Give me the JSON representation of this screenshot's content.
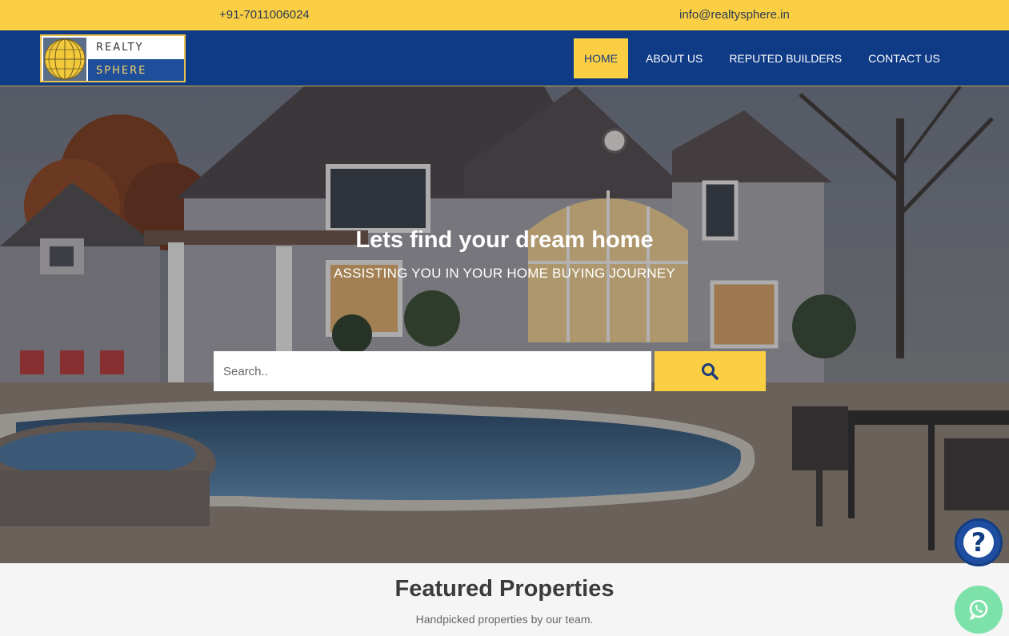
{
  "topbar": {
    "phone": "+91-7011006024",
    "email": "info@realtysphere.in"
  },
  "brand": {
    "line1": "REALTY",
    "line2": "SPHERE",
    "globe_icon": "globe-icon"
  },
  "nav": {
    "items": [
      {
        "label": "HOME",
        "active": true
      },
      {
        "label": "ABOUT US",
        "active": false
      },
      {
        "label": "REPUTED BUILDERS",
        "active": false
      },
      {
        "label": "CONTACT US",
        "active": false
      }
    ]
  },
  "hero": {
    "title": "Lets find your dream home",
    "subtitle": "ASSISTING YOU IN YOUR HOME BUYING JOURNEY",
    "search_placeholder": "Search..",
    "search_icon": "magnifier-icon"
  },
  "featured": {
    "title": "Featured Properties",
    "subtitle": "Handpicked properties by our team."
  },
  "floating": {
    "help_glyph": "?",
    "help_icon": "question-icon",
    "whatsapp_icon": "whatsapp-icon"
  },
  "colors": {
    "accent_yellow": "#fbcf43",
    "nav_blue": "#0e3a86",
    "whatsapp_green": "#7de1aa"
  }
}
